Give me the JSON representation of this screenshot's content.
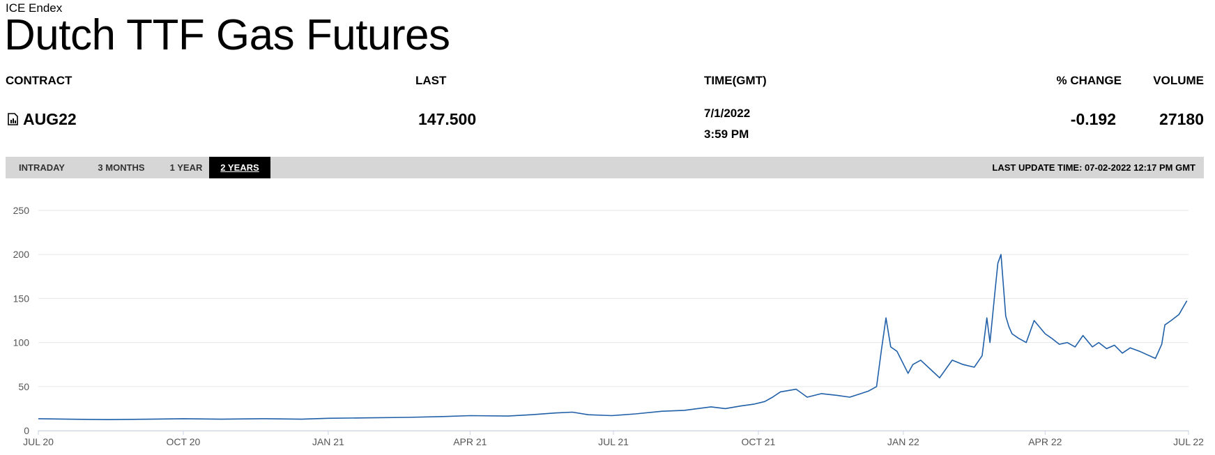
{
  "header": {
    "exchange": "ICE Endex",
    "title": "Dutch TTF Gas Futures"
  },
  "columns": {
    "contract": "CONTRACT",
    "last": "LAST",
    "time": "TIME(GMT)",
    "change": "% CHANGE",
    "volume": "VOLUME"
  },
  "row": {
    "contract": "AUG22",
    "last": "147.500",
    "date": "7/1/2022",
    "time": "3:59 PM",
    "change": "-0.192",
    "volume": "27180"
  },
  "tabs": [
    "INTRADAY",
    "3 MONTHS",
    "1 YEAR",
    "2 YEARS"
  ],
  "active_tab": "2 YEARS",
  "last_update": "LAST UPDATE TIME: 07-02-2022 12:17 PM GMT",
  "colors": {
    "line": "#1f5fa8",
    "grid": "#e6e6e6",
    "toolbar": "#d6d6d6"
  },
  "chart_data": {
    "type": "line",
    "title": "",
    "xlabel": "",
    "ylabel": "",
    "ylim": [
      0,
      250
    ],
    "yticks": [
      "0",
      "50",
      "100",
      "150",
      "200",
      "250"
    ],
    "xticks": [
      "JUL 20",
      "OCT 20",
      "JAN 21",
      "APR 21",
      "JUL 21",
      "OCT 21",
      "JAN 22",
      "APR 22",
      "JUL 22"
    ],
    "grid": true,
    "legend": "none",
    "series": [
      {
        "x": [
          "2020-07-01",
          "2020-07-20",
          "2020-08-15",
          "2020-09-10",
          "2020-10-01",
          "2020-10-25",
          "2020-11-20",
          "2020-12-15",
          "2021-01-01",
          "2021-01-25",
          "2021-02-20",
          "2021-03-15",
          "2021-04-01",
          "2021-04-25",
          "2021-05-10",
          "2021-05-25",
          "2021-06-05",
          "2021-06-15",
          "2021-06-30",
          "2021-07-15",
          "2021-08-01",
          "2021-08-15",
          "2021-09-01",
          "2021-09-10",
          "2021-09-20",
          "2021-09-28",
          "2021-10-05",
          "2021-10-10",
          "2021-10-15",
          "2021-10-25",
          "2021-11-01",
          "2021-11-10",
          "2021-11-20",
          "2021-11-28",
          "2021-12-05",
          "2021-12-10",
          "2021-12-15",
          "2021-12-18",
          "2021-12-21",
          "2021-12-24",
          "2021-12-28",
          "2022-01-04",
          "2022-01-07",
          "2022-01-12",
          "2022-01-18",
          "2022-01-24",
          "2022-02-01",
          "2022-02-08",
          "2022-02-15",
          "2022-02-20",
          "2022-02-23",
          "2022-02-25",
          "2022-02-28",
          "2022-03-02",
          "2022-03-04",
          "2022-03-07",
          "2022-03-09",
          "2022-03-11",
          "2022-03-15",
          "2022-03-20",
          "2022-03-25",
          "2022-04-01",
          "2022-04-05",
          "2022-04-10",
          "2022-04-15",
          "2022-04-20",
          "2022-04-25",
          "2022-05-01",
          "2022-05-05",
          "2022-05-10",
          "2022-05-15",
          "2022-05-20",
          "2022-05-25",
          "2022-05-31",
          "2022-06-05",
          "2022-06-10",
          "2022-06-14",
          "2022-06-16",
          "2022-06-20",
          "2022-06-25",
          "2022-06-30"
        ],
        "values": [
          13.5,
          13.0,
          12.5,
          13.0,
          13.5,
          13.0,
          13.5,
          13.0,
          14.0,
          14.5,
          15.0,
          16.0,
          17.0,
          16.5,
          18.0,
          20.0,
          21.0,
          18.0,
          17.0,
          19.0,
          22.0,
          23.0,
          27.0,
          25.0,
          28.0,
          30.0,
          33.0,
          38.0,
          44.0,
          47.0,
          38.0,
          42.0,
          40.0,
          38.0,
          42.0,
          45.0,
          50.0,
          90.0,
          128.0,
          95.0,
          90.0,
          65.0,
          75.0,
          80.0,
          70.0,
          60.0,
          80.0,
          75.0,
          72.0,
          85.0,
          128.0,
          100.0,
          155.0,
          190.0,
          200.0,
          130.0,
          118.0,
          110.0,
          105.0,
          100.0,
          125.0,
          110.0,
          105.0,
          98.0,
          100.0,
          95.0,
          108.0,
          95.0,
          100.0,
          93.0,
          97.0,
          88.0,
          94.0,
          90.0,
          86.0,
          82.0,
          98.0,
          120.0,
          125.0,
          132.0,
          147.5
        ]
      }
    ]
  }
}
